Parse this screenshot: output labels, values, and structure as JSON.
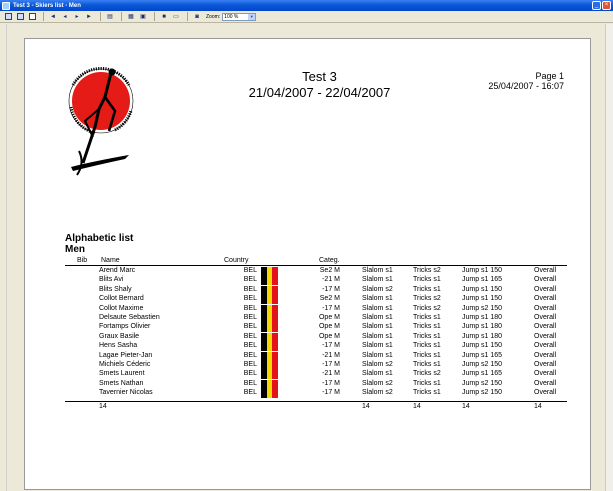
{
  "window": {
    "title": "Test 3 - Skiers list - Men"
  },
  "toolbar": {
    "zoom_label": "Zoom:",
    "zoom_value": "100 %"
  },
  "report": {
    "title": "Test 3",
    "dates": "21/04/2007 - 22/04/2007",
    "page": "Page 1",
    "printed": "25/04/2007 - 16:07",
    "logo_text": "NAMURS WATERSKI CLUB — V.Z.W.",
    "list_title": "Alphabetic list",
    "group_title": "Men",
    "columns": {
      "bib": "Bib",
      "name": "Name",
      "country": "Country",
      "categ": "Categ."
    },
    "flag_colors": [
      "#000000",
      "#f5d900",
      "#e2141a"
    ],
    "rows": [
      {
        "name": "Arend Marc",
        "country": "BEL",
        "categ": "Se2 M",
        "slalom": "Slalom s1",
        "tricks": "Tricks s2",
        "jump": "Jump s1 150",
        "overall": "Overall"
      },
      {
        "name": "Blits Avi",
        "country": "BEL",
        "categ": "-21 M",
        "slalom": "Slalom s1",
        "tricks": "Tricks s1",
        "jump": "Jump s1 165",
        "overall": "Overall"
      },
      {
        "name": "Blits Shaly",
        "country": "BEL",
        "categ": "-17 M",
        "slalom": "Slalom s2",
        "tricks": "Tricks s1",
        "jump": "Jump s1 150",
        "overall": "Overall"
      },
      {
        "name": "Collot Bernard",
        "country": "BEL",
        "categ": "Se2 M",
        "slalom": "Slalom s1",
        "tricks": "Tricks s2",
        "jump": "Jump s1 150",
        "overall": "Overall"
      },
      {
        "name": "Collot Maxime",
        "country": "BEL",
        "categ": "-17 M",
        "slalom": "Slalom s1",
        "tricks": "Tricks s2",
        "jump": "Jump s2 150",
        "overall": "Overall"
      },
      {
        "name": "Delsaute Sebastien",
        "country": "BEL",
        "categ": "Ope M",
        "slalom": "Slalom s1",
        "tricks": "Tricks s1",
        "jump": "Jump s1 180",
        "overall": "Overall"
      },
      {
        "name": "Fortamps Olivier",
        "country": "BEL",
        "categ": "Ope M",
        "slalom": "Slalom s1",
        "tricks": "Tricks s1",
        "jump": "Jump s1 180",
        "overall": "Overall"
      },
      {
        "name": "Graux Basile",
        "country": "BEL",
        "categ": "Ope M",
        "slalom": "Slalom s1",
        "tricks": "Tricks s1",
        "jump": "Jump s1 180",
        "overall": "Overall"
      },
      {
        "name": "Hens Sasha",
        "country": "BEL",
        "categ": "-17 M",
        "slalom": "Slalom s1",
        "tricks": "Tricks s1",
        "jump": "Jump s1 150",
        "overall": "Overall"
      },
      {
        "name": "Lagae Pieter-Jan",
        "country": "BEL",
        "categ": "-21 M",
        "slalom": "Slalom s1",
        "tricks": "Tricks s1",
        "jump": "Jump s1 165",
        "overall": "Overall"
      },
      {
        "name": "Michiels Céderic",
        "country": "BEL",
        "categ": "-17 M",
        "slalom": "Slalom s2",
        "tricks": "Tricks s1",
        "jump": "Jump s2 150",
        "overall": "Overall"
      },
      {
        "name": "Smets Laurent",
        "country": "BEL",
        "categ": "-21 M",
        "slalom": "Slalom s1",
        "tricks": "Tricks s2",
        "jump": "Jump s1 165",
        "overall": "Overall"
      },
      {
        "name": "Smets Nathan",
        "country": "BEL",
        "categ": "-17 M",
        "slalom": "Slalom s2",
        "tricks": "Tricks s1",
        "jump": "Jump s2 150",
        "overall": "Overall"
      },
      {
        "name": "Tavernier Nicolas",
        "country": "BEL",
        "categ": "-17 M",
        "slalom": "Slalom s2",
        "tricks": "Tricks s1",
        "jump": "Jump s2 150",
        "overall": "Overall"
      }
    ],
    "totals": {
      "count": "14",
      "slalom": "14",
      "tricks": "14",
      "jump": "14",
      "overall": "14"
    }
  }
}
